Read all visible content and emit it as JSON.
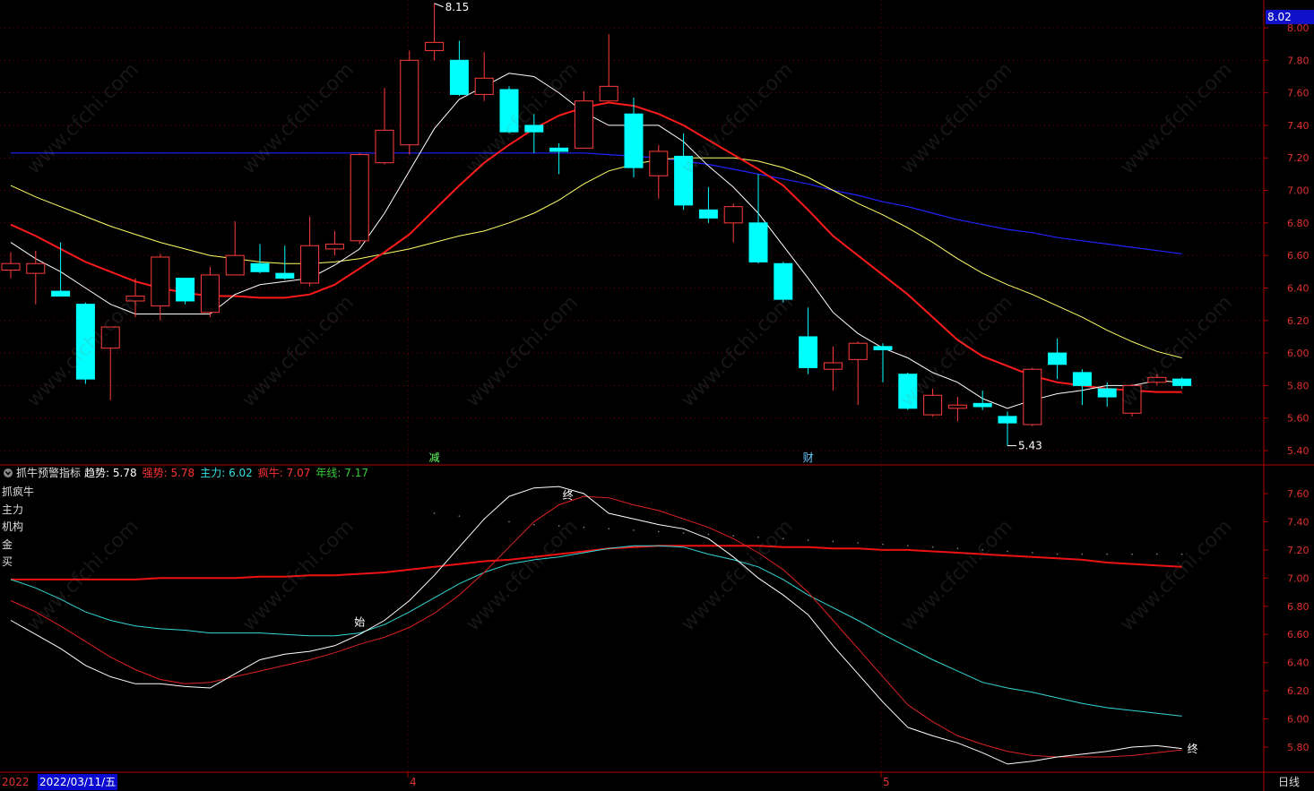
{
  "watermark": "www.cfchi.com",
  "colors": {
    "up": "#ff3c3c",
    "down": "#00ffff",
    "ma5": "#ffffff",
    "ma10": "#ff1a1a",
    "ma20": "#ffff66",
    "ma60": "#2222ff",
    "grid": "#8b0000",
    "axis": "#b00000"
  },
  "main_panel": {
    "price_tag": "8.02",
    "y_ticks": [
      "8.00",
      "7.80",
      "7.60",
      "7.40",
      "7.20",
      "7.00",
      "6.80",
      "6.60",
      "6.40",
      "6.20",
      "6.00",
      "5.80",
      "5.60",
      "5.40"
    ],
    "high_label": "8.15",
    "low_label": "5.43",
    "markers": [
      {
        "text": "减",
        "color": "#66ff66"
      },
      {
        "text": "财",
        "color": "#66ccff"
      }
    ]
  },
  "indicator_panel": {
    "title": "抓牛预警指标",
    "legend": [
      {
        "label": "趋势:",
        "value": "5.78",
        "color": "#ffffff"
      },
      {
        "label": "强势:",
        "value": "5.78",
        "color": "#ff3333"
      },
      {
        "label": "主力:",
        "value": "6.02",
        "color": "#33e0e0"
      },
      {
        "label": "疯牛:",
        "value": "7.07",
        "color": "#ff3333"
      },
      {
        "label": "年线:",
        "value": "7.17",
        "color": "#33cc33"
      }
    ],
    "side_labels": [
      "抓疯牛",
      "主力",
      "机构",
      "金",
      "买"
    ],
    "y_ticks": [
      "7.60",
      "7.40",
      "7.20",
      "7.00",
      "6.80",
      "6.60",
      "6.40",
      "6.20",
      "6.00",
      "5.80"
    ],
    "annotations": [
      "始",
      "终",
      "终"
    ]
  },
  "time_axis": {
    "year_label": "2022",
    "date_tag": "2022/03/11/五",
    "month_labels": [
      "4",
      "5"
    ],
    "period": "日线"
  },
  "chart_data": {
    "type": "candlestick",
    "ylim": [
      5.35,
      8.1
    ],
    "candles": [
      {
        "o": 6.51,
        "c": 6.55,
        "h": 6.62,
        "l": 6.46
      },
      {
        "o": 6.49,
        "c": 6.55,
        "h": 6.63,
        "l": 6.3
      },
      {
        "o": 6.38,
        "c": 6.35,
        "h": 6.68,
        "l": 6.35
      },
      {
        "o": 6.3,
        "c": 5.84,
        "h": 6.31,
        "l": 5.81
      },
      {
        "o": 6.03,
        "c": 6.16,
        "h": 6.12,
        "l": 5.71
      },
      {
        "o": 6.32,
        "c": 6.35,
        "h": 6.46,
        "l": 6.22
      },
      {
        "o": 6.29,
        "c": 6.59,
        "h": 6.61,
        "l": 6.2
      },
      {
        "o": 6.46,
        "c": 6.32,
        "h": 6.46,
        "l": 6.3
      },
      {
        "o": 6.25,
        "c": 6.48,
        "h": 6.53,
        "l": 6.22
      },
      {
        "o": 6.48,
        "c": 6.6,
        "h": 6.81,
        "l": 6.5
      },
      {
        "o": 6.55,
        "c": 6.5,
        "h": 6.67,
        "l": 6.49
      },
      {
        "o": 6.49,
        "c": 6.46,
        "h": 6.66,
        "l": 6.45
      },
      {
        "o": 6.43,
        "c": 6.66,
        "h": 6.84,
        "l": 6.41
      },
      {
        "o": 6.64,
        "c": 6.67,
        "h": 6.75,
        "l": 6.6
      },
      {
        "o": 6.69,
        "c": 7.22,
        "h": 7.23,
        "l": 6.67
      },
      {
        "o": 7.17,
        "c": 7.37,
        "h": 7.63,
        "l": 7.16
      },
      {
        "o": 7.28,
        "c": 7.8,
        "h": 7.86,
        "l": 7.22
      },
      {
        "o": 7.86,
        "c": 7.91,
        "h": 8.15,
        "l": 7.8
      },
      {
        "o": 7.8,
        "c": 7.59,
        "h": 7.92,
        "l": 7.58
      },
      {
        "o": 7.59,
        "c": 7.69,
        "h": 7.85,
        "l": 7.55
      },
      {
        "o": 7.62,
        "c": 7.36,
        "h": 7.64,
        "l": 7.35
      },
      {
        "o": 7.4,
        "c": 7.36,
        "h": 7.47,
        "l": 7.23
      },
      {
        "o": 7.26,
        "c": 7.24,
        "h": 7.29,
        "l": 7.1
      },
      {
        "o": 7.26,
        "c": 7.55,
        "h": 7.61,
        "l": 7.26
      },
      {
        "o": 7.55,
        "c": 7.64,
        "h": 7.96,
        "l": 7.56
      },
      {
        "o": 7.47,
        "c": 7.14,
        "h": 7.57,
        "l": 7.08
      },
      {
        "o": 7.09,
        "c": 7.24,
        "h": 7.28,
        "l": 6.95
      },
      {
        "o": 7.21,
        "c": 6.91,
        "h": 7.35,
        "l": 6.88
      },
      {
        "o": 6.88,
        "c": 6.83,
        "h": 7.02,
        "l": 6.8
      },
      {
        "o": 6.8,
        "c": 6.9,
        "h": 6.92,
        "l": 6.68
      },
      {
        "o": 6.8,
        "c": 6.56,
        "h": 7.1,
        "l": 6.55
      },
      {
        "o": 6.55,
        "c": 6.33,
        "h": 6.56,
        "l": 6.31
      },
      {
        "o": 6.1,
        "c": 5.91,
        "h": 6.28,
        "l": 5.87
      },
      {
        "o": 5.9,
        "c": 5.94,
        "h": 6.04,
        "l": 5.77
      },
      {
        "o": 5.96,
        "c": 6.06,
        "h": 6.07,
        "l": 5.68
      },
      {
        "o": 6.04,
        "c": 6.02,
        "h": 6.06,
        "l": 5.82
      },
      {
        "o": 5.87,
        "c": 5.66,
        "h": 5.88,
        "l": 5.65
      },
      {
        "o": 5.62,
        "c": 5.74,
        "h": 5.78,
        "l": 5.61
      },
      {
        "o": 5.66,
        "c": 5.68,
        "h": 5.73,
        "l": 5.58
      },
      {
        "o": 5.69,
        "c": 5.67,
        "h": 5.77,
        "l": 5.65
      },
      {
        "o": 5.61,
        "c": 5.57,
        "h": 5.64,
        "l": 5.43
      },
      {
        "o": 5.56,
        "c": 5.9,
        "h": 5.91,
        "l": 5.55
      },
      {
        "o": 6.0,
        "c": 5.93,
        "h": 6.09,
        "l": 5.84
      },
      {
        "o": 5.88,
        "c": 5.8,
        "h": 5.9,
        "l": 5.68
      },
      {
        "o": 5.78,
        "c": 5.73,
        "h": 5.82,
        "l": 5.67
      },
      {
        "o": 5.63,
        "c": 5.8,
        "h": 5.81,
        "l": 5.61
      },
      {
        "o": 5.82,
        "c": 5.85,
        "h": 5.87,
        "l": 5.8
      },
      {
        "o": 5.84,
        "c": 5.8,
        "h": 5.85,
        "l": 5.78
      }
    ],
    "ma5": [
      6.68,
      6.58,
      6.5,
      6.4,
      6.3,
      6.24,
      6.24,
      6.24,
      6.24,
      6.36,
      6.42,
      6.44,
      6.46,
      6.54,
      6.64,
      6.86,
      7.12,
      7.38,
      7.56,
      7.64,
      7.72,
      7.7,
      7.6,
      7.48,
      7.4,
      7.4,
      7.4,
      7.3,
      7.15,
      7.02,
      6.86,
      6.66,
      6.46,
      6.25,
      6.12,
      6.03,
      5.97,
      5.88,
      5.82,
      5.72,
      5.66,
      5.71,
      5.75,
      5.77,
      5.8,
      5.8,
      5.83,
      5.82
    ],
    "ma10": [
      6.79,
      6.72,
      6.64,
      6.56,
      6.5,
      6.44,
      6.4,
      6.37,
      6.35,
      6.35,
      6.34,
      6.34,
      6.36,
      6.42,
      6.52,
      6.62,
      6.73,
      6.88,
      7.03,
      7.17,
      7.28,
      7.38,
      7.46,
      7.51,
      7.54,
      7.52,
      7.47,
      7.4,
      7.31,
      7.22,
      7.13,
      7.03,
      6.88,
      6.72,
      6.6,
      6.48,
      6.36,
      6.22,
      6.08,
      5.98,
      5.92,
      5.86,
      5.82,
      5.8,
      5.78,
      5.77,
      5.76,
      5.76
    ],
    "ma20": [
      7.03,
      6.96,
      6.9,
      6.84,
      6.78,
      6.73,
      6.68,
      6.64,
      6.6,
      6.58,
      6.56,
      6.55,
      6.55,
      6.56,
      6.58,
      6.61,
      6.64,
      6.68,
      6.72,
      6.75,
      6.8,
      6.86,
      6.94,
      7.04,
      7.12,
      7.16,
      7.19,
      7.2,
      7.2,
      7.2,
      7.18,
      7.14,
      7.08,
      7.0,
      6.92,
      6.85,
      6.77,
      6.68,
      6.58,
      6.49,
      6.42,
      6.36,
      6.29,
      6.22,
      6.14,
      6.07,
      6.01,
      5.97
    ],
    "ma60": [
      7.23,
      7.23,
      7.23,
      7.23,
      7.23,
      7.23,
      7.23,
      7.23,
      7.23,
      7.23,
      7.23,
      7.23,
      7.23,
      7.23,
      7.23,
      7.23,
      7.23,
      7.23,
      7.23,
      7.23,
      7.23,
      7.23,
      7.23,
      7.23,
      7.22,
      7.21,
      7.2,
      7.18,
      7.16,
      7.13,
      7.1,
      7.07,
      7.04,
      7.0,
      6.97,
      6.93,
      6.9,
      6.86,
      6.82,
      6.79,
      6.76,
      6.74,
      6.71,
      6.69,
      6.67,
      6.65,
      6.63,
      6.61
    ],
    "indicator": {
      "ylim": [
        5.62,
        7.75
      ],
      "trend": [
        6.7,
        6.6,
        6.5,
        6.38,
        6.3,
        6.25,
        6.25,
        6.23,
        6.22,
        6.32,
        6.42,
        6.46,
        6.48,
        6.52,
        6.6,
        6.7,
        6.84,
        7.02,
        7.22,
        7.42,
        7.58,
        7.64,
        7.65,
        7.6,
        7.46,
        7.42,
        7.38,
        7.35,
        7.28,
        7.15,
        7.0,
        6.88,
        6.74,
        6.52,
        6.32,
        6.12,
        5.94,
        5.88,
        5.83,
        5.76,
        5.68,
        5.7,
        5.73,
        5.75,
        5.77,
        5.8,
        5.81,
        5.79
      ],
      "strong": [
        6.84,
        6.76,
        6.66,
        6.55,
        6.44,
        6.35,
        6.28,
        6.25,
        6.26,
        6.3,
        6.34,
        6.38,
        6.42,
        6.47,
        6.53,
        6.58,
        6.65,
        6.75,
        6.88,
        7.04,
        7.22,
        7.4,
        7.52,
        7.58,
        7.57,
        7.52,
        7.48,
        7.42,
        7.36,
        7.28,
        7.18,
        7.06,
        6.9,
        6.7,
        6.5,
        6.3,
        6.1,
        5.98,
        5.88,
        5.82,
        5.77,
        5.74,
        5.73,
        5.73,
        5.73,
        5.74,
        5.76,
        5.78
      ],
      "main": [
        6.99,
        6.93,
        6.85,
        6.76,
        6.7,
        6.66,
        6.64,
        6.63,
        6.61,
        6.61,
        6.61,
        6.6,
        6.59,
        6.59,
        6.61,
        6.67,
        6.76,
        6.86,
        6.96,
        7.04,
        7.1,
        7.13,
        7.15,
        7.18,
        7.21,
        7.23,
        7.23,
        7.22,
        7.17,
        7.13,
        7.08,
        6.99,
        6.88,
        6.79,
        6.7,
        6.6,
        6.51,
        6.42,
        6.34,
        6.26,
        6.22,
        6.19,
        6.15,
        6.11,
        6.08,
        6.06,
        6.04,
        6.02
      ],
      "crazy": [
        6.99,
        6.99,
        6.99,
        6.99,
        6.99,
        6.99,
        7.0,
        7.0,
        7.0,
        7.0,
        7.01,
        7.01,
        7.02,
        7.02,
        7.03,
        7.04,
        7.06,
        7.08,
        7.1,
        7.12,
        7.13,
        7.15,
        7.17,
        7.19,
        7.21,
        7.22,
        7.23,
        7.23,
        7.23,
        7.23,
        7.23,
        7.22,
        7.22,
        7.21,
        7.21,
        7.2,
        7.2,
        7.19,
        7.18,
        7.17,
        7.16,
        7.15,
        7.14,
        7.13,
        7.11,
        7.1,
        7.09,
        7.08
      ],
      "yearline": [
        7.65,
        7.65,
        7.64,
        7.64,
        7.63,
        7.62,
        7.61,
        7.6,
        7.59,
        7.58,
        7.57,
        7.56,
        7.55,
        7.54,
        7.52,
        7.5,
        7.48,
        7.46,
        7.44,
        7.42,
        7.4,
        7.38,
        7.37,
        7.36,
        7.35,
        7.34,
        7.33,
        7.32,
        7.31,
        7.3,
        7.29,
        7.28,
        7.27,
        7.26,
        7.25,
        7.24,
        7.23,
        7.22,
        7.21,
        7.2,
        7.19,
        7.18,
        7.17,
        7.17,
        7.17,
        7.17,
        7.17,
        7.17
      ]
    }
  }
}
